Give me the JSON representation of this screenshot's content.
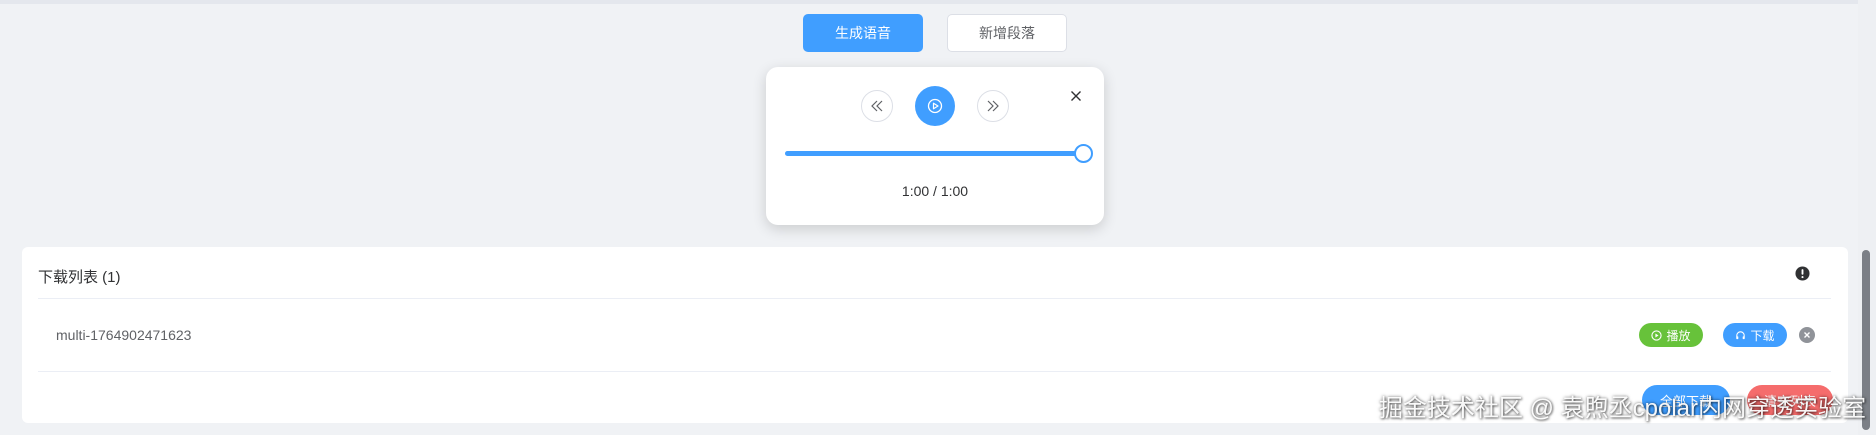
{
  "toolbar": {
    "generate_label": "生成语音",
    "add_paragraph_label": "新增段落"
  },
  "player": {
    "time_text": "1:00 / 1:00",
    "progress": 1.0,
    "icons": {
      "prev": "double-chevron-left-icon",
      "play": "play-circle-icon",
      "next": "double-chevron-right-icon",
      "close": "close-icon"
    }
  },
  "downloads": {
    "title": "下载列表 (1)",
    "items": [
      {
        "name": "multi-1764902471623",
        "play_label": "播放",
        "download_label": "下载"
      }
    ],
    "footer": {
      "download_all_label": "全部下载",
      "clear_label": "清空列表"
    }
  },
  "watermark": "掘金技术社区 @ 袁煦丞cpolar内网穿透实验室",
  "colors": {
    "primary": "#409eff",
    "success": "#67c23a",
    "danger": "#f56c6c",
    "background": "#f0f2f5"
  }
}
